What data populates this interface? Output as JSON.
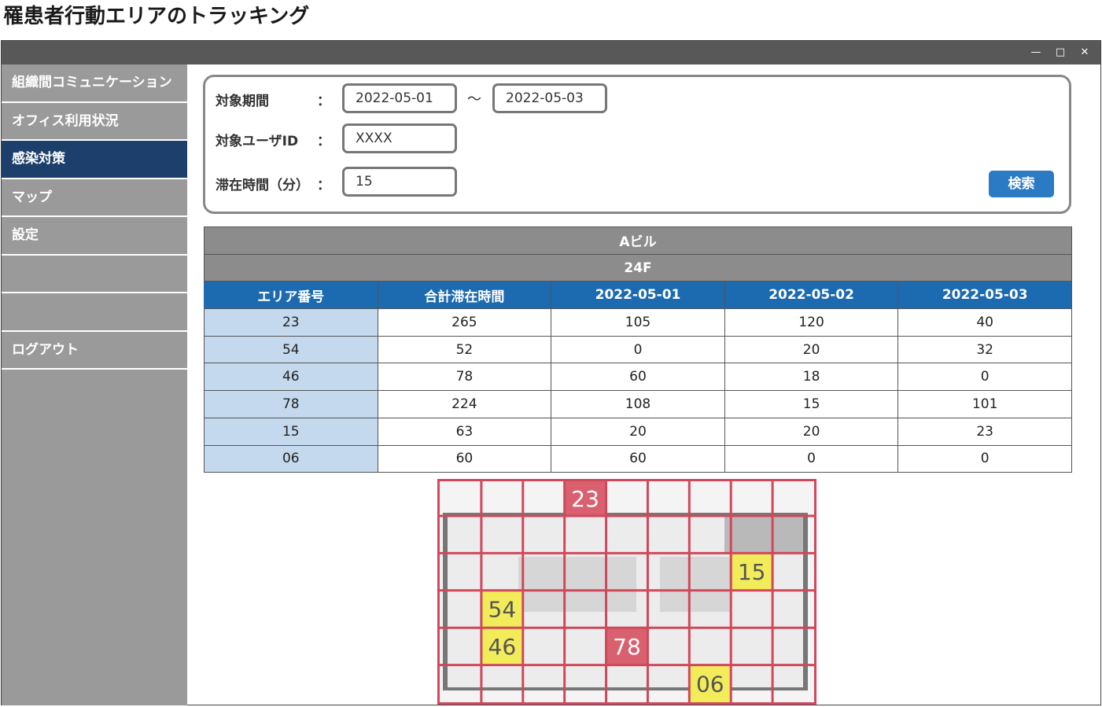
{
  "page": {
    "title": "罹患者行動エリアのトラッキング"
  },
  "window_controls": {
    "minimize": "—",
    "maximize": "□",
    "close": "✕"
  },
  "sidebar": {
    "items": [
      {
        "label": "組織間コミュニケーション"
      },
      {
        "label": "オフィス利用状況"
      },
      {
        "label": "感染対策",
        "active": true
      },
      {
        "label": "マップ"
      },
      {
        "label": "設定"
      },
      {
        "label": ""
      },
      {
        "label": ""
      },
      {
        "label": "ログアウト"
      }
    ]
  },
  "filter": {
    "period_label": "対象期間",
    "user_label": "対象ユーザID",
    "stay_label": "滞在時間（分）",
    "colon": "：",
    "tilde": "〜",
    "period_from": "2022-05-01",
    "period_to": "2022-05-03",
    "user_id": "XXXX",
    "stay_minutes": "15",
    "search_label": "検索"
  },
  "table": {
    "building": "Aビル",
    "floor": "24F",
    "headers": [
      "エリア番号",
      "合計滞在時間",
      "2022-05-01",
      "2022-05-02",
      "2022-05-03"
    ],
    "rows": [
      [
        "23",
        "265",
        "105",
        "120",
        "40"
      ],
      [
        "54",
        "52",
        "0",
        "20",
        "32"
      ],
      [
        "46",
        "78",
        "60",
        "18",
        "0"
      ],
      [
        "78",
        "224",
        "108",
        "15",
        "101"
      ],
      [
        "15",
        "63",
        "20",
        "20",
        "23"
      ],
      [
        "06",
        "60",
        "60",
        "0",
        "0"
      ]
    ]
  },
  "map": {
    "grid_cols": 9,
    "grid_rows": 5,
    "grid_color": "#d0485a",
    "highlights": [
      {
        "label": "23",
        "col": 3,
        "row": 0,
        "color": "#d9606e"
      },
      {
        "label": "15",
        "col": 7,
        "row": 2,
        "color": "#f2ec5a"
      },
      {
        "label": "54",
        "col": 1,
        "row": 3,
        "color": "#f2ec5a"
      },
      {
        "label": "46",
        "col": 1,
        "row": 4,
        "color": "#f2ec5a"
      },
      {
        "label": "78",
        "col": 4,
        "row": 4,
        "color": "#d9606e"
      },
      {
        "label": "06",
        "col": 6,
        "row": 5,
        "color": "#f2ec5a"
      }
    ]
  }
}
